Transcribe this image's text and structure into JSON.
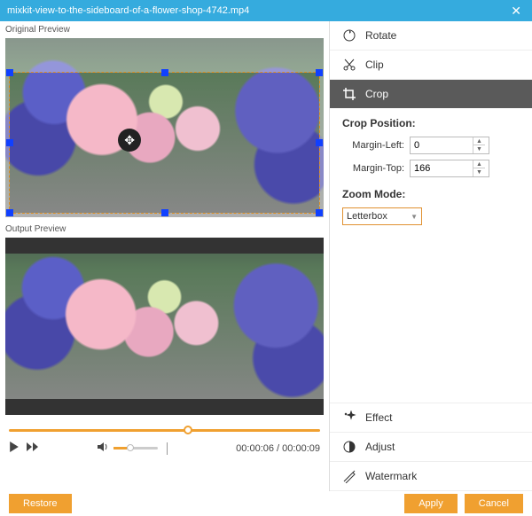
{
  "titlebar": {
    "filename": "mixkit-view-to-the-sideboard-of-a-flower-shop-4742.mp4"
  },
  "labels": {
    "original": "Original Preview",
    "output": "Output Preview"
  },
  "playback": {
    "current": "00:00:06",
    "total": "00:00:09",
    "sep": " / "
  },
  "tools": {
    "rotate": "Rotate",
    "clip": "Clip",
    "crop": "Crop",
    "effect": "Effect",
    "adjust": "Adjust",
    "watermark": "Watermark"
  },
  "crop": {
    "position_label": "Crop Position:",
    "margin_left_label": "Margin-Left:",
    "margin_left_value": "0",
    "margin_top_label": "Margin-Top:",
    "margin_top_value": "166",
    "zoom_label": "Zoom Mode:",
    "zoom_value": "Letterbox"
  },
  "buttons": {
    "restore": "Restore",
    "apply": "Apply",
    "cancel": "Cancel"
  }
}
